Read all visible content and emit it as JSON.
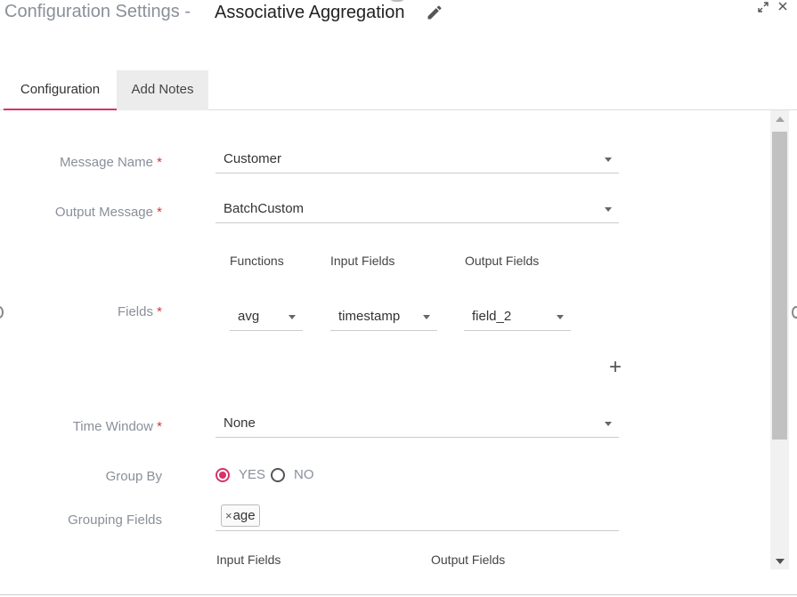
{
  "header": {
    "title_prefix": "Configuration Settings -",
    "title_name": "Associative Aggregation",
    "icons": [
      "edit-icon",
      "expand-icon",
      "close-icon"
    ]
  },
  "tabs": [
    {
      "label": "Configuration",
      "active": true
    },
    {
      "label": "Add Notes",
      "active": false
    }
  ],
  "form": {
    "required_mark": "*",
    "message_name": {
      "label": "Message Name",
      "value": "Customer"
    },
    "output_message": {
      "label": "Output Message",
      "value": "BatchCustom"
    },
    "fields": {
      "label": "Fields",
      "col_functions": "Functions",
      "col_input": "Input Fields",
      "col_output": "Output Fields",
      "rows": [
        {
          "function": "avg",
          "input": "timestamp",
          "output": "field_2"
        }
      ],
      "add_label": "+"
    },
    "time_window": {
      "label": "Time Window",
      "value": "None"
    },
    "group_by": {
      "label": "Group By",
      "yes": "YES",
      "no": "NO",
      "selected": "YES"
    },
    "grouping_fields": {
      "label": "Grouping Fields",
      "chips": [
        "age"
      ],
      "remove_glyph": "×"
    },
    "bottom_cols": {
      "input": "Input Fields",
      "output": "Output Fields"
    }
  },
  "colors": {
    "accent": "#d6336c",
    "required": "#e03131",
    "muted_text": "#8a8f99"
  }
}
